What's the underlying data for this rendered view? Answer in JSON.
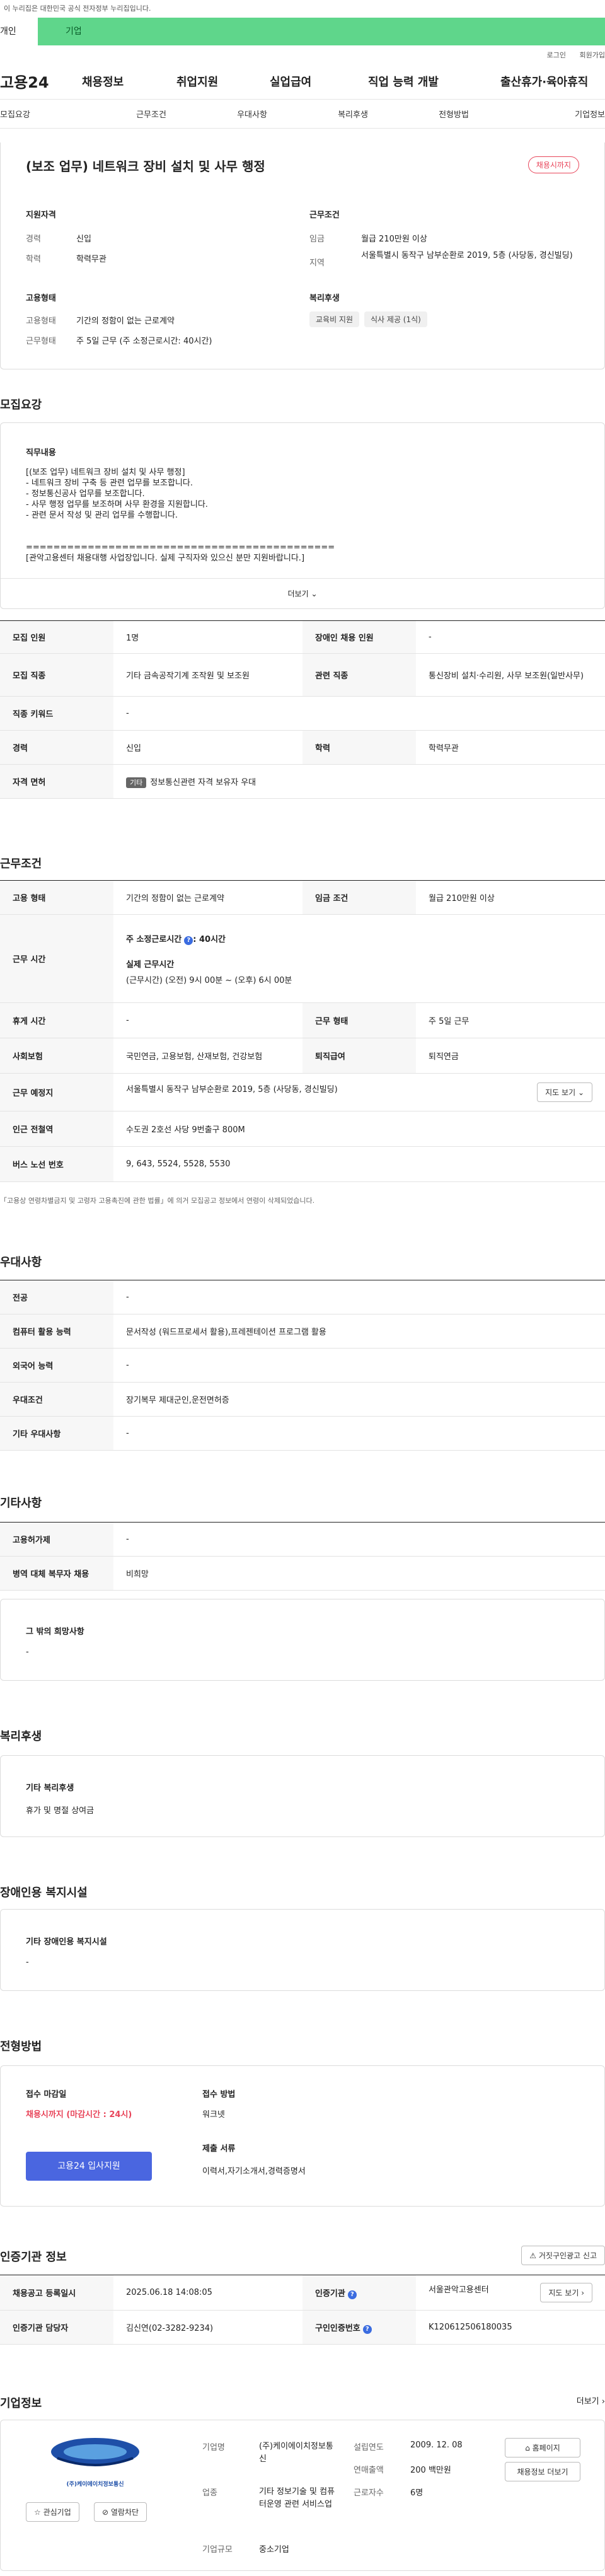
{
  "top": {
    "notice": "이 누리집은 대한민국 공식 전자정부 누리집입니다.",
    "tab_personal": "개인",
    "tab_company": "기업"
  },
  "util": {
    "login": "로그인",
    "join": "회원가입"
  },
  "gnb": {
    "logo": "고용24",
    "menu": [
      "채용정보",
      "취업지원",
      "실업급여",
      "직업 능력 개발",
      "출산휴가·육아휴직"
    ]
  },
  "lnb": [
    "모집요강",
    "근무조건",
    "우대사항",
    "복리후생",
    "전형방법",
    "기업정보"
  ],
  "header": {
    "title": "(보조 업무) 네트워크 장비 설치 및 사무 행정",
    "status": "채용시까지",
    "qual_title": "지원자격",
    "career_label": "경력",
    "career_value": "신입",
    "edu_label": "학력",
    "edu_value": "학력무관",
    "cond_title": "근무조건",
    "wage_label": "임금",
    "wage_value": "월급 210만원 이상",
    "region_label": "지역",
    "region_value": "서울특별시 동작구 남부순환로 2019, 5층 (사당동, 경신빌딩)",
    "emp_title": "고용형태",
    "emptype_label": "고용형태",
    "emptype_value": "기간의 정함이 없는 근로계약",
    "worktype_label": "근무형태",
    "worktype_value": "주 5일 근무 (주 소정근로시간: 40시간)",
    "welfare_title": "복리후생",
    "welfare_chips": [
      "교육비 지원",
      "식사 제공 (1식)"
    ]
  },
  "recruit": {
    "title": "모집요강",
    "content_title": "직무내용",
    "lines": [
      "[(보조 업무) 네트워크 장비 설치 및 사무 행정]",
      "- 네트워크 장비 구축 등 관련 업무를 보조합니다.",
      "- 정보통신공사 업무를 보조합니다.",
      "- 사무 행정 업무를 보조하며 사무 환경을 지원합니다.",
      "- 관련 문서 작성 및 관리 업무를 수행합니다.",
      "",
      "",
      "=============================================",
      "[관악고용센터 채용대행 사업장입니다. 실제 구직자와 있으신 분만 지원바랍니다.]"
    ],
    "more": "더보기",
    "rows": {
      "count_k": "모집 인원",
      "count_v": "1명",
      "disabled_k": "장애인 채용 인원",
      "disabled_v": "-",
      "job_k": "모집 직종",
      "job_v": "기타 금속공작기계 조작원 및 보조원",
      "related_k": "관련 직종",
      "related_v": "통신장비 설치·수리원, 사무 보조원(일반사무)",
      "keyword_k": "직종 키워드",
      "keyword_v": "-",
      "career_k": "경력",
      "career_v": "신입",
      "edu_k": "학력",
      "edu_v": "학력무관",
      "license_k": "자격 면허",
      "license_tag": "기타",
      "license_v": "정보통신관련 자격 보유자 우대"
    }
  },
  "condition": {
    "title": "근무조건",
    "emp_k": "고용 형태",
    "emp_v": "기간의 정함이 없는 근로계약",
    "wage_k": "임금 조건",
    "wage_v": "월급 210만원 이상",
    "time_k": "근무 시간",
    "time_std": "주 소정근로시간",
    "time_std_v": ": 40시간",
    "time_detail_title": "실제 근무시간",
    "time_detail": "(근무시간) (오전) 9시 00분 ~ (오후) 6시 00분",
    "rest_k": "휴게 시간",
    "rest_v": "-",
    "form_k": "근무 형태",
    "form_v": "주 5일 근무",
    "ins_k": "사회보험",
    "ins_v": "국민연금, 고용보험, 산재보험, 건강보험",
    "sev_k": "퇴직급여",
    "sev_v": "퇴직연금",
    "place_k": "근무 예정지",
    "place_v": "서울특별시 동작구 남부순환로 2019, 5층 (사당동, 경신빌딩)",
    "map_btn": "지도 보기",
    "subway_k": "인근 전철역",
    "subway_v": "수도권 2호선 사당 9번출구 800M",
    "bus_k": "버스 노선 번호",
    "bus_v": "9, 643, 5524, 5528, 5530",
    "note": "「고용상 연령차별금지 및 고령자 고용촉진에 관한 법률」에 의거 모집공고 정보에서 연령이 삭제되었습니다."
  },
  "prefer": {
    "title": "우대사항",
    "major_k": "전공",
    "major_v": "-",
    "computer_k": "컴퓨터 활용 능력",
    "computer_v": "문서작성 (워드프로세서 활용),프레젠테이션 프로그램 활용",
    "lang_k": "외국어 능력",
    "lang_v": "-",
    "cond_k": "우대조건",
    "cond_v": "장기복무 제대군인,운전면허증",
    "etc_k": "기타 우대사항",
    "etc_v": "-"
  },
  "etc": {
    "title": "기타사항",
    "deadline_k": "고용허가제",
    "deadline_v": "-",
    "military_k": "병역 대체 복무자 채용",
    "military_v": "비희망",
    "hope_title": "그 밖의 희망사항",
    "hope_v": "-"
  },
  "welfare": {
    "title": "복리후생",
    "box_title": "기타 복리후생",
    "box_v": "휴가 및 명절 상여금"
  },
  "disabled": {
    "title": "장애인용 복지시설",
    "box_title": "기타 장애인용 복지시설",
    "box_v": "-"
  },
  "process": {
    "title": "전형방법",
    "deadline_label": "접수 마감일",
    "deadline_v": "채용시까지 (마감시간 : 24시)",
    "apply_btn": "고용24 입사지원",
    "method_label": "접수 방법",
    "method_v": "워크넷",
    "docs_label": "제출 서류",
    "docs_v": "이력서,자기소개서,경력증명서"
  },
  "agency": {
    "title": "인증기관 정보",
    "report_btn": "거짓구인광고 신고",
    "reg_k": "채용공고 등록일시",
    "reg_v": "2025.06.18 14:08:05",
    "org_k": "인증기관",
    "org_v": "서울관악고용센터",
    "map_btn": "지도 보기",
    "mgr_k": "인증기관 담당자",
    "mgr_v": "김신연(02-3282-9234)",
    "num_k": "구인인증번호",
    "num_v": "K120612506180035"
  },
  "company": {
    "title": "기업정보",
    "more": "더보기",
    "logo_text": "(주)케이에이치정보통신",
    "fav_btn": "관심기업",
    "block_btn": "열람차단",
    "name_k": "기업명",
    "name_v": "(주)케이에이치정보통신",
    "biz_k": "업종",
    "biz_v": "기타 정보기술 및 컴퓨터운영 관련 서비스업",
    "size_k": "기업규모",
    "size_v": "중소기업",
    "found_k": "설립연도",
    "found_v": "2009. 12. 08",
    "sales_k": "연매출액",
    "sales_v": "200 백만원",
    "emp_k": "근로자수",
    "emp_v": "6명",
    "homepage_btn": "홈페이지",
    "jobs_btn": "채용정보 더보기"
  },
  "colors": {
    "accent": "#3b6ce0",
    "green": "#5fd68b",
    "red": "#e8455a"
  }
}
